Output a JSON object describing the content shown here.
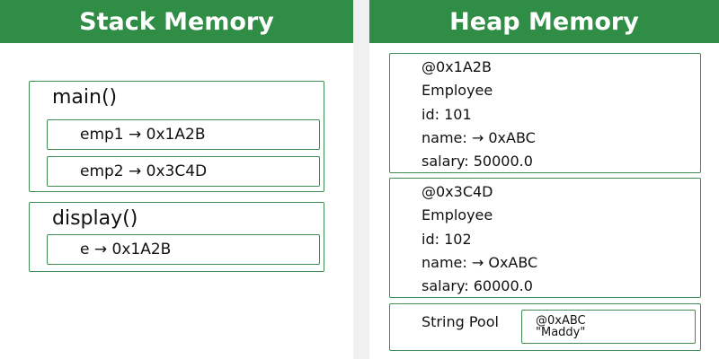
{
  "stack": {
    "title": "Stack Memory",
    "frames": [
      {
        "name": "main()",
        "vars": [
          "emp1 → 0x1A2B",
          "emp2 → 0x3C4D"
        ]
      },
      {
        "name": "display()",
        "vars": [
          "e → 0x1A2B"
        ]
      }
    ]
  },
  "heap": {
    "title": "Heap Memory",
    "objects": [
      {
        "address": "@0x1A2B",
        "type": "Employee",
        "id": "id: 101",
        "name": "name: → 0xABC",
        "salary": "salary: 50000.0"
      },
      {
        "address": "@0x3C4D",
        "type": "Employee",
        "id": "id: 102",
        "name": "name: → OxABC",
        "salary": "salary: 60000.0"
      }
    ],
    "string_pool": {
      "label": "String Pool",
      "address": "@0xABC",
      "value": "\"Maddy\""
    }
  },
  "colors": {
    "header_bg": "#2f8d46",
    "border": "#3d8c52",
    "gutter": "#f0f0f0"
  }
}
